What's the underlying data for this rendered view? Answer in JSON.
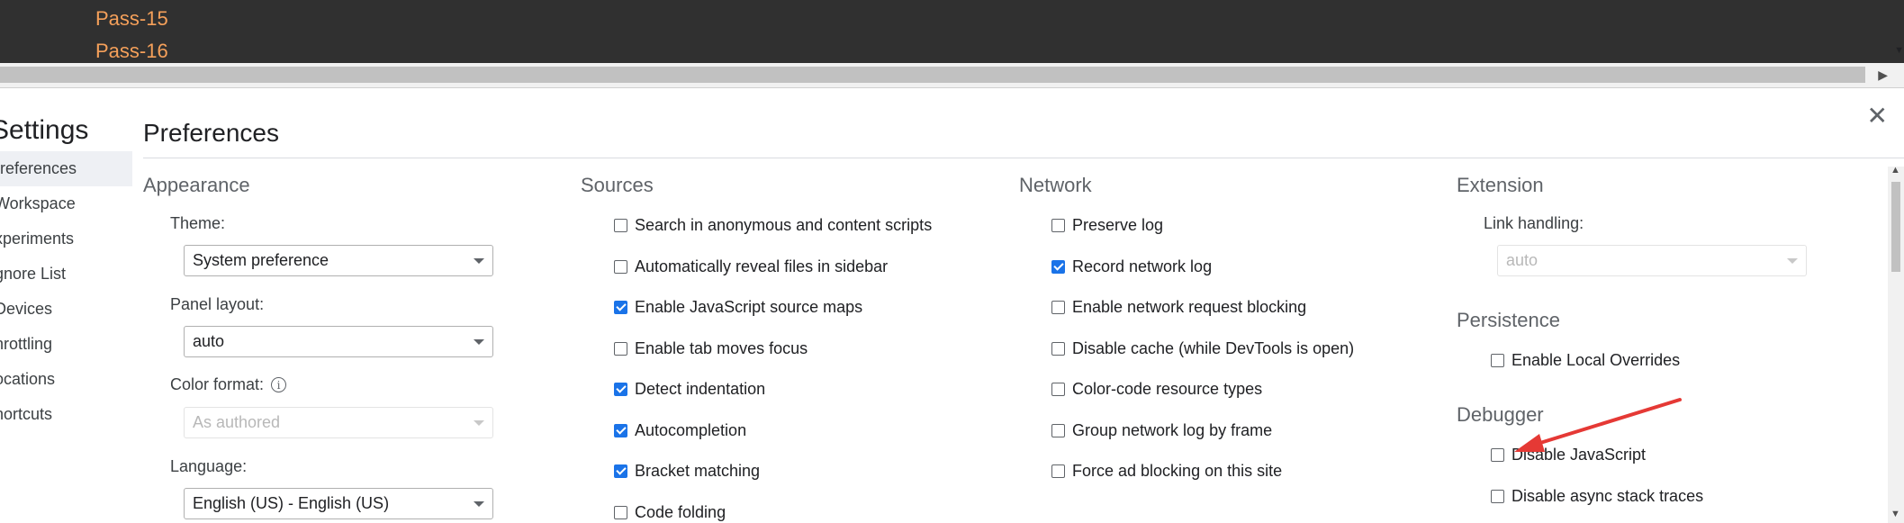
{
  "console": {
    "lines": [
      "Pass-15",
      "Pass-16"
    ]
  },
  "settings": {
    "title": "Settings",
    "nav": [
      "references",
      "Workspace",
      "xperiments",
      "gnore List",
      "Devices",
      "hrottling",
      "ocations",
      "hortcuts"
    ]
  },
  "page": {
    "title": "Preferences"
  },
  "appearance": {
    "title": "Appearance",
    "theme_label": "Theme:",
    "theme_value": "System preference",
    "panel_layout_label": "Panel layout:",
    "panel_layout_value": "auto",
    "color_format_label": "Color format:",
    "color_format_value": "As authored",
    "language_label": "Language:",
    "language_value": "English (US) - English (US)"
  },
  "sources": {
    "title": "Sources",
    "items": [
      {
        "label": "Search in anonymous and content scripts",
        "checked": false
      },
      {
        "label": "Automatically reveal files in sidebar",
        "checked": false
      },
      {
        "label": "Enable JavaScript source maps",
        "checked": true
      },
      {
        "label": "Enable tab moves focus",
        "checked": false
      },
      {
        "label": "Detect indentation",
        "checked": true
      },
      {
        "label": "Autocompletion",
        "checked": true
      },
      {
        "label": "Bracket matching",
        "checked": true
      },
      {
        "label": "Code folding",
        "checked": false
      }
    ]
  },
  "network": {
    "title": "Network",
    "items": [
      {
        "label": "Preserve log",
        "checked": false
      },
      {
        "label": "Record network log",
        "checked": true
      },
      {
        "label": "Enable network request blocking",
        "checked": false
      },
      {
        "label": "Disable cache (while DevTools is open)",
        "checked": false
      },
      {
        "label": "Color-code resource types",
        "checked": false
      },
      {
        "label": "Group network log by frame",
        "checked": false
      },
      {
        "label": "Force ad blocking on this site",
        "checked": false
      }
    ]
  },
  "extension": {
    "title": "Extension",
    "link_handling_label": "Link handling:",
    "link_handling_value": "auto"
  },
  "persistence": {
    "title": "Persistence",
    "items": [
      {
        "label": "Enable Local Overrides",
        "checked": false
      }
    ]
  },
  "debugger": {
    "title": "Debugger",
    "items": [
      {
        "label": "Disable JavaScript",
        "checked": false
      },
      {
        "label": "Disable async stack traces",
        "checked": false
      }
    ]
  },
  "colors": {
    "accent": "#1a73e8",
    "console_text": "#f5a05a",
    "annotation": "#e53935"
  }
}
